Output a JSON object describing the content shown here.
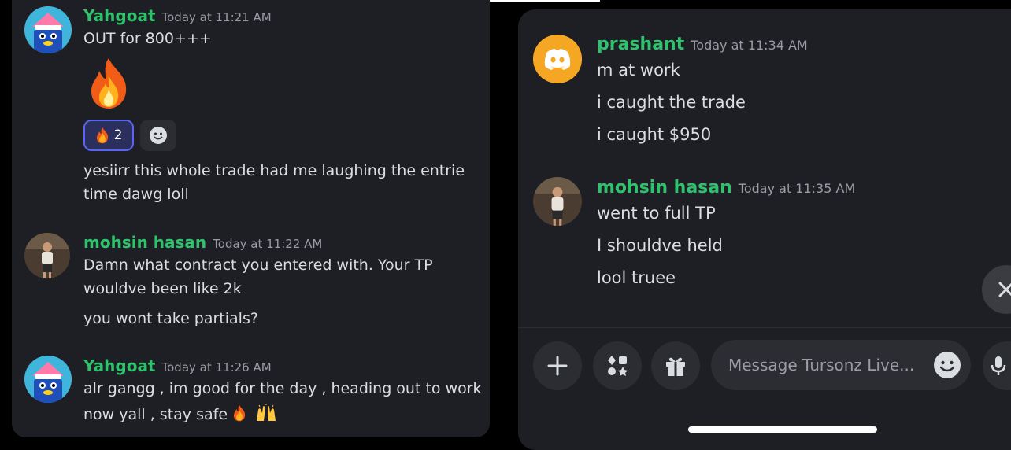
{
  "left_messages": [
    {
      "username": "Yahgoat",
      "timestamp": "Today at 11:21 AM",
      "lines": [
        "OUT for 800+++"
      ],
      "reaction_count": "2",
      "extra_lines": [
        "yesiirr this whole trade had me laughing the entrie",
        "time dawg loll"
      ]
    },
    {
      "username": "mohsin hasan",
      "timestamp": "Today at 11:22 AM",
      "lines": [
        "Damn what contract you entered with. Your TP",
        "wouldve been like 2k",
        "you wont take partials?"
      ]
    },
    {
      "username": "Yahgoat",
      "timestamp": "Today at 11:26 AM",
      "lines": [
        "alr gangg , im good for the day , heading out to work",
        "now yall , stay safe"
      ]
    }
  ],
  "right_messages": [
    {
      "username": "prashant",
      "timestamp": "Today at 11:34 AM",
      "lines": [
        "m at work",
        "i caught the trade",
        "i caught $950"
      ]
    },
    {
      "username": "mohsin hasan",
      "timestamp": "Today at 11:35 AM",
      "lines": [
        "went to full TP",
        "I shouldve held",
        "lool truee"
      ]
    }
  ],
  "composer": {
    "placeholder": "Message Tursonz Live..."
  },
  "colors": {
    "username": "#2fc26d",
    "panel_bg": "#1e1f24",
    "reaction_active_bg": "#2a2f5e",
    "reaction_active_border": "#5865f2",
    "discord_orange": "#f5a623"
  },
  "icons": [
    "fire-emoji",
    "smiley-add-icon",
    "discord-logo-icon",
    "plus-icon",
    "apps-icon",
    "gift-icon",
    "emoji-icon",
    "mic-icon",
    "close-icon",
    "raised-hands-emoji"
  ]
}
